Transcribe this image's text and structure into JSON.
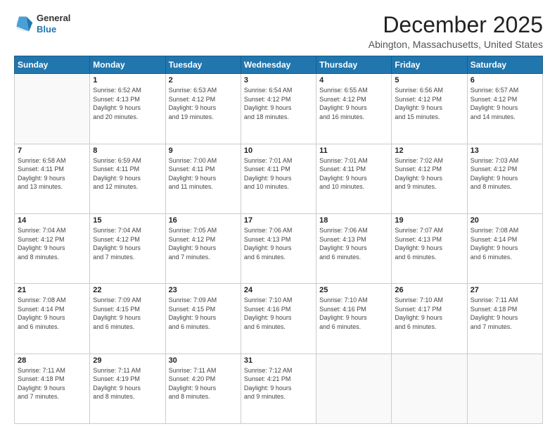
{
  "header": {
    "logo": {
      "general": "General",
      "blue": "Blue"
    },
    "title": "December 2025",
    "location": "Abington, Massachusetts, United States"
  },
  "weekdays": [
    "Sunday",
    "Monday",
    "Tuesday",
    "Wednesday",
    "Thursday",
    "Friday",
    "Saturday"
  ],
  "weeks": [
    [
      {
        "day": "",
        "info": ""
      },
      {
        "day": "1",
        "info": "Sunrise: 6:52 AM\nSunset: 4:13 PM\nDaylight: 9 hours\nand 20 minutes."
      },
      {
        "day": "2",
        "info": "Sunrise: 6:53 AM\nSunset: 4:12 PM\nDaylight: 9 hours\nand 19 minutes."
      },
      {
        "day": "3",
        "info": "Sunrise: 6:54 AM\nSunset: 4:12 PM\nDaylight: 9 hours\nand 18 minutes."
      },
      {
        "day": "4",
        "info": "Sunrise: 6:55 AM\nSunset: 4:12 PM\nDaylight: 9 hours\nand 16 minutes."
      },
      {
        "day": "5",
        "info": "Sunrise: 6:56 AM\nSunset: 4:12 PM\nDaylight: 9 hours\nand 15 minutes."
      },
      {
        "day": "6",
        "info": "Sunrise: 6:57 AM\nSunset: 4:12 PM\nDaylight: 9 hours\nand 14 minutes."
      }
    ],
    [
      {
        "day": "7",
        "info": "Sunrise: 6:58 AM\nSunset: 4:11 PM\nDaylight: 9 hours\nand 13 minutes."
      },
      {
        "day": "8",
        "info": "Sunrise: 6:59 AM\nSunset: 4:11 PM\nDaylight: 9 hours\nand 12 minutes."
      },
      {
        "day": "9",
        "info": "Sunrise: 7:00 AM\nSunset: 4:11 PM\nDaylight: 9 hours\nand 11 minutes."
      },
      {
        "day": "10",
        "info": "Sunrise: 7:01 AM\nSunset: 4:11 PM\nDaylight: 9 hours\nand 10 minutes."
      },
      {
        "day": "11",
        "info": "Sunrise: 7:01 AM\nSunset: 4:11 PM\nDaylight: 9 hours\nand 10 minutes."
      },
      {
        "day": "12",
        "info": "Sunrise: 7:02 AM\nSunset: 4:12 PM\nDaylight: 9 hours\nand 9 minutes."
      },
      {
        "day": "13",
        "info": "Sunrise: 7:03 AM\nSunset: 4:12 PM\nDaylight: 9 hours\nand 8 minutes."
      }
    ],
    [
      {
        "day": "14",
        "info": "Sunrise: 7:04 AM\nSunset: 4:12 PM\nDaylight: 9 hours\nand 8 minutes."
      },
      {
        "day": "15",
        "info": "Sunrise: 7:04 AM\nSunset: 4:12 PM\nDaylight: 9 hours\nand 7 minutes."
      },
      {
        "day": "16",
        "info": "Sunrise: 7:05 AM\nSunset: 4:12 PM\nDaylight: 9 hours\nand 7 minutes."
      },
      {
        "day": "17",
        "info": "Sunrise: 7:06 AM\nSunset: 4:13 PM\nDaylight: 9 hours\nand 6 minutes."
      },
      {
        "day": "18",
        "info": "Sunrise: 7:06 AM\nSunset: 4:13 PM\nDaylight: 9 hours\nand 6 minutes."
      },
      {
        "day": "19",
        "info": "Sunrise: 7:07 AM\nSunset: 4:13 PM\nDaylight: 9 hours\nand 6 minutes."
      },
      {
        "day": "20",
        "info": "Sunrise: 7:08 AM\nSunset: 4:14 PM\nDaylight: 9 hours\nand 6 minutes."
      }
    ],
    [
      {
        "day": "21",
        "info": "Sunrise: 7:08 AM\nSunset: 4:14 PM\nDaylight: 9 hours\nand 6 minutes."
      },
      {
        "day": "22",
        "info": "Sunrise: 7:09 AM\nSunset: 4:15 PM\nDaylight: 9 hours\nand 6 minutes."
      },
      {
        "day": "23",
        "info": "Sunrise: 7:09 AM\nSunset: 4:15 PM\nDaylight: 9 hours\nand 6 minutes."
      },
      {
        "day": "24",
        "info": "Sunrise: 7:10 AM\nSunset: 4:16 PM\nDaylight: 9 hours\nand 6 minutes."
      },
      {
        "day": "25",
        "info": "Sunrise: 7:10 AM\nSunset: 4:16 PM\nDaylight: 9 hours\nand 6 minutes."
      },
      {
        "day": "26",
        "info": "Sunrise: 7:10 AM\nSunset: 4:17 PM\nDaylight: 9 hours\nand 6 minutes."
      },
      {
        "day": "27",
        "info": "Sunrise: 7:11 AM\nSunset: 4:18 PM\nDaylight: 9 hours\nand 7 minutes."
      }
    ],
    [
      {
        "day": "28",
        "info": "Sunrise: 7:11 AM\nSunset: 4:18 PM\nDaylight: 9 hours\nand 7 minutes."
      },
      {
        "day": "29",
        "info": "Sunrise: 7:11 AM\nSunset: 4:19 PM\nDaylight: 9 hours\nand 8 minutes."
      },
      {
        "day": "30",
        "info": "Sunrise: 7:11 AM\nSunset: 4:20 PM\nDaylight: 9 hours\nand 8 minutes."
      },
      {
        "day": "31",
        "info": "Sunrise: 7:12 AM\nSunset: 4:21 PM\nDaylight: 9 hours\nand 9 minutes."
      },
      {
        "day": "",
        "info": ""
      },
      {
        "day": "",
        "info": ""
      },
      {
        "day": "",
        "info": ""
      }
    ]
  ]
}
